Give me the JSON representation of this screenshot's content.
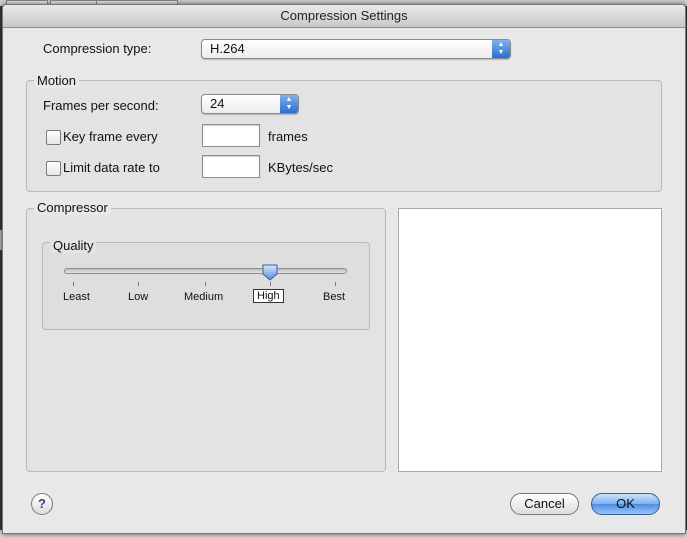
{
  "window": {
    "title": "Compression Settings"
  },
  "compression": {
    "label": "Compression type:",
    "value": "H.264"
  },
  "motion": {
    "title": "Motion",
    "fps_label": "Frames per second:",
    "fps_value": "24",
    "keyframe": {
      "label": "Key frame every",
      "value": "",
      "unit": "frames",
      "checked": false
    },
    "limit_rate": {
      "label": "Limit data rate to",
      "value": "",
      "unit": "KBytes/sec",
      "checked": false
    }
  },
  "compressor": {
    "title": "Compressor",
    "quality": {
      "title": "Quality",
      "ticks": [
        "Least",
        "Low",
        "Medium",
        "High",
        "Best"
      ],
      "selected": "High",
      "level_fraction": 0.75
    }
  },
  "buttons": {
    "cancel": "Cancel",
    "ok": "OK",
    "help": "?"
  },
  "colors": {
    "accent": "#4d8de2",
    "window_bg": "#e8e8e8"
  }
}
